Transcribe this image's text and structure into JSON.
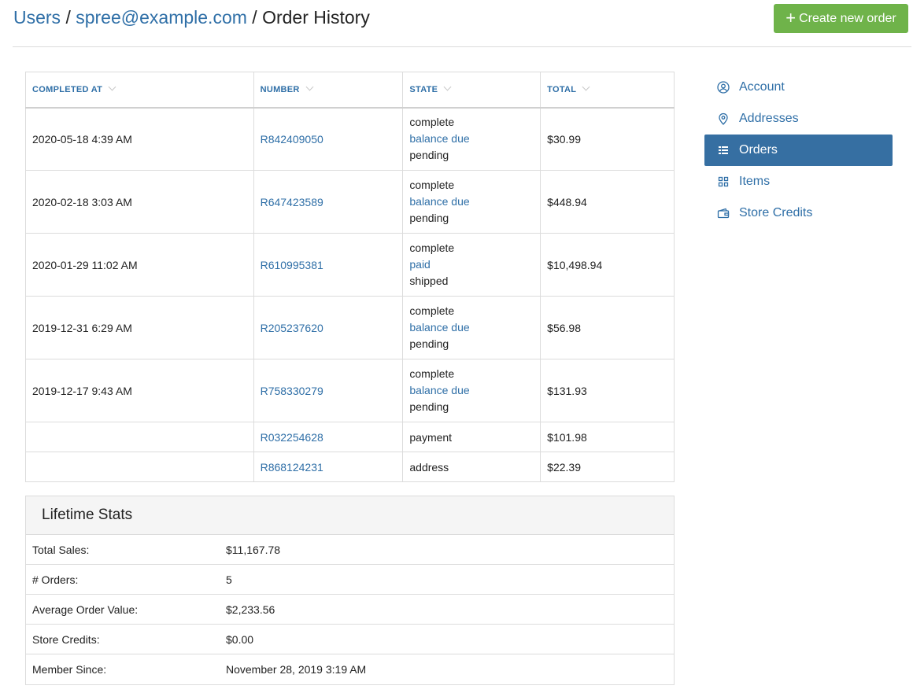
{
  "breadcrumb": {
    "users": "Users",
    "sep1": " / ",
    "email": "spree@example.com",
    "sep2": " / ",
    "current": "Order History"
  },
  "actions": {
    "create_label": "Create new order",
    "create_icon": "plus-icon"
  },
  "orders_table": {
    "headers": [
      "COMPLETED AT",
      "NUMBER",
      "STATE",
      "TOTAL"
    ],
    "rows": [
      {
        "completed_at": "2020-05-18 4:39 AM",
        "number": "R842409050",
        "state": [
          "complete",
          "balance due",
          "pending"
        ],
        "total": "$30.99"
      },
      {
        "completed_at": "2020-02-18 3:03 AM",
        "number": "R647423589",
        "state": [
          "complete",
          "balance due",
          "pending"
        ],
        "total": "$448.94"
      },
      {
        "completed_at": "2020-01-29 11:02 AM",
        "number": "R610995381",
        "state": [
          "complete",
          "paid",
          "shipped"
        ],
        "total": "$10,498.94"
      },
      {
        "completed_at": "2019-12-31 6:29 AM",
        "number": "R205237620",
        "state": [
          "complete",
          "balance due",
          "pending"
        ],
        "total": "$56.98"
      },
      {
        "completed_at": "2019-12-17 9:43 AM",
        "number": "R758330279",
        "state": [
          "complete",
          "balance due",
          "pending"
        ],
        "total": "$131.93"
      },
      {
        "completed_at": "",
        "number": "R032254628",
        "state": [
          "payment"
        ],
        "total": "$101.98"
      },
      {
        "completed_at": "",
        "number": "R868124231",
        "state": [
          "address"
        ],
        "total": "$22.39"
      }
    ]
  },
  "lifetime_stats": {
    "title": "Lifetime Stats",
    "rows": [
      {
        "label": "Total Sales:",
        "value": "$11,167.78"
      },
      {
        "label": "# Orders:",
        "value": "5"
      },
      {
        "label": "Average Order Value:",
        "value": "$2,233.56"
      },
      {
        "label": "Store Credits:",
        "value": "$0.00"
      },
      {
        "label": "Member Since:",
        "value": "November 28, 2019 3:19 AM"
      }
    ]
  },
  "sidebar": {
    "items": [
      {
        "label": "Account",
        "icon": "user-circle-icon",
        "active": false
      },
      {
        "label": "Addresses",
        "icon": "map-pin-icon",
        "active": false
      },
      {
        "label": "Orders",
        "icon": "list-icon",
        "active": true
      },
      {
        "label": "Items",
        "icon": "grid-icon",
        "active": false
      },
      {
        "label": "Store Credits",
        "icon": "wallet-icon",
        "active": false
      }
    ]
  },
  "colors": {
    "link": "#2f6fa7",
    "button": "#6fb34a",
    "active_nav": "#366fa2",
    "header_bg": "#f5f5f5"
  }
}
